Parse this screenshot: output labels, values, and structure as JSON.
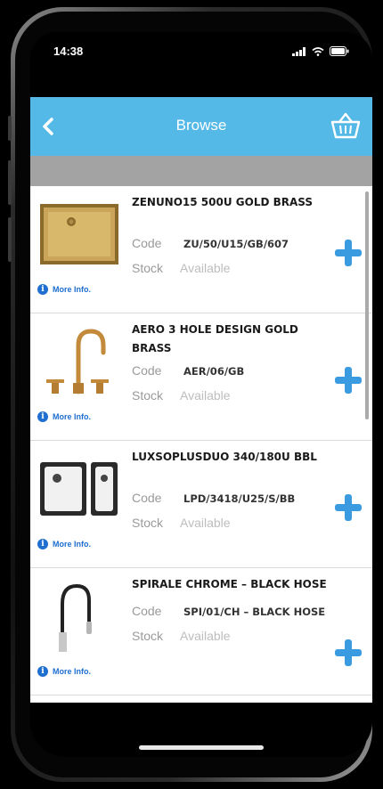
{
  "status_bar": {
    "time": "14:38"
  },
  "nav": {
    "title": "Browse",
    "back_icon": "chevron-left-icon",
    "cart_icon": "basket-icon",
    "color": "#55b9e8"
  },
  "labels": {
    "code": "Code",
    "stock": "Stock",
    "more_info": "More Info."
  },
  "products": [
    {
      "name": "ZENUNO15 500U GOLD BRASS",
      "code": "ZU/50/U15/GB/607",
      "stock": "Available"
    },
    {
      "name": "AERO 3 HOLE DESIGN GOLD BRASS",
      "code": "AER/06/GB",
      "stock": "Available"
    },
    {
      "name": "LUXSOPLUSDUO 340/180U BBL",
      "code": "LPD/3418/U25/S/BB",
      "stock": "Available"
    },
    {
      "name": "SPIRALE CHROME – BLACK HOSE",
      "code": "SPI/01/CH – BLACK HOSE",
      "stock": "Available"
    }
  ],
  "accent_color": "#3a9be0"
}
